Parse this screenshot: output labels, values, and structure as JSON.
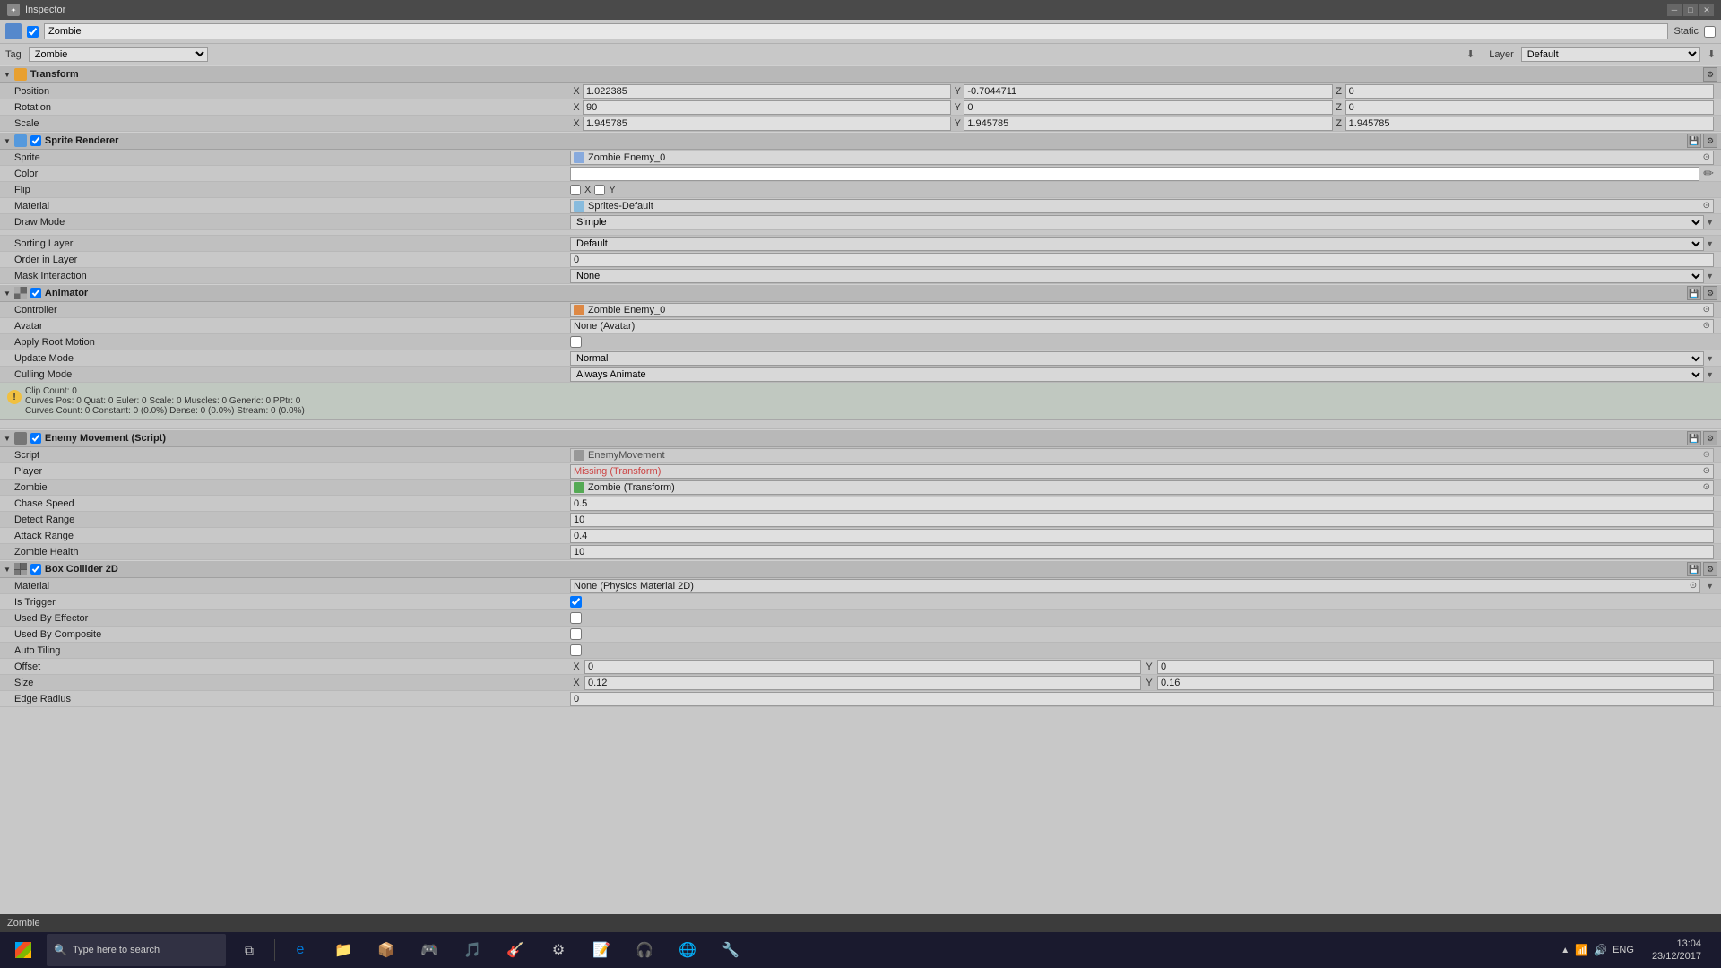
{
  "titlebar": {
    "icon": "unity-icon",
    "title": "Inspector",
    "minimize": "─",
    "maximize": "□",
    "close": "✕"
  },
  "object": {
    "icon_color": "#5588cc",
    "checkbox_checked": true,
    "name": "Zombie",
    "static_label": "Static",
    "tag_label": "Tag",
    "tag_value": "Zombie",
    "layer_label": "Layer",
    "layer_value": "Default"
  },
  "transform": {
    "title": "Transform",
    "position_label": "Position",
    "pos_x": "1.022385",
    "pos_y": "-0.7044711",
    "pos_z": "0",
    "rotation_label": "Rotation",
    "rot_x": "90",
    "rot_y": "0",
    "rot_z": "0",
    "scale_label": "Scale",
    "scale_x": "1.945785",
    "scale_y": "1.945785",
    "scale_z": "1.945785"
  },
  "sprite_renderer": {
    "title": "Sprite Renderer",
    "sprite_label": "Sprite",
    "sprite_value": "Zombie Enemy_0",
    "color_label": "Color",
    "flip_label": "Flip",
    "flip_x": "X",
    "flip_y": "Y",
    "material_label": "Material",
    "material_value": "Sprites-Default",
    "draw_mode_label": "Draw Mode",
    "draw_mode_value": "Simple",
    "sorting_layer_label": "Sorting Layer",
    "sorting_layer_value": "Default",
    "order_label": "Order in Layer",
    "order_value": "0",
    "mask_label": "Mask Interaction",
    "mask_value": "None"
  },
  "animator": {
    "title": "Animator",
    "controller_label": "Controller",
    "controller_value": "Zombie Enemy_0",
    "avatar_label": "Avatar",
    "avatar_value": "None (Avatar)",
    "apply_root_label": "Apply Root Motion",
    "update_mode_label": "Update Mode",
    "update_mode_value": "Normal",
    "culling_label": "Culling Mode",
    "culling_value": "Always Animate",
    "info_line1": "Clip Count: 0",
    "info_line2": "Curves Pos: 0 Quat: 0 Euler: 0 Scale: 0 Muscles: 0 Generic: 0 PPtr: 0",
    "info_line3": "Curves Count: 0 Constant: 0 (0.0%) Dense: 0 (0.0%) Stream: 0 (0.0%)"
  },
  "enemy_movement": {
    "title": "Enemy Movement (Script)",
    "script_label": "Script",
    "script_value": "EnemyMovement",
    "player_label": "Player",
    "player_value": "Missing (Transform)",
    "zombie_label": "Zombie",
    "zombie_value": "Zombie (Transform)",
    "chase_speed_label": "Chase Speed",
    "chase_speed_value": "0.5",
    "detect_range_label": "Detect Range",
    "detect_range_value": "10",
    "attack_range_label": "Attack Range",
    "attack_range_value": "0.4",
    "zombie_health_label": "Zombie Health",
    "zombie_health_value": "10"
  },
  "box_collider": {
    "title": "Box Collider 2D",
    "material_label": "Material",
    "material_value": "None (Physics Material 2D)",
    "is_trigger_label": "Is Trigger",
    "used_effector_label": "Used By Effector",
    "used_composite_label": "Used By Composite",
    "auto_tiling_label": "Auto Tiling",
    "offset_label": "Offset",
    "offset_x": "0",
    "offset_y": "0",
    "size_label": "Size",
    "size_x": "0.12",
    "size_y": "0.16",
    "edge_radius_label": "Edge Radius",
    "edge_radius_value": "0"
  },
  "status_bar": {
    "text": "Zombie"
  },
  "taskbar": {
    "search_placeholder": "Type here to search",
    "time": "13:04",
    "date": "23/12/2017",
    "language": "ENG"
  }
}
